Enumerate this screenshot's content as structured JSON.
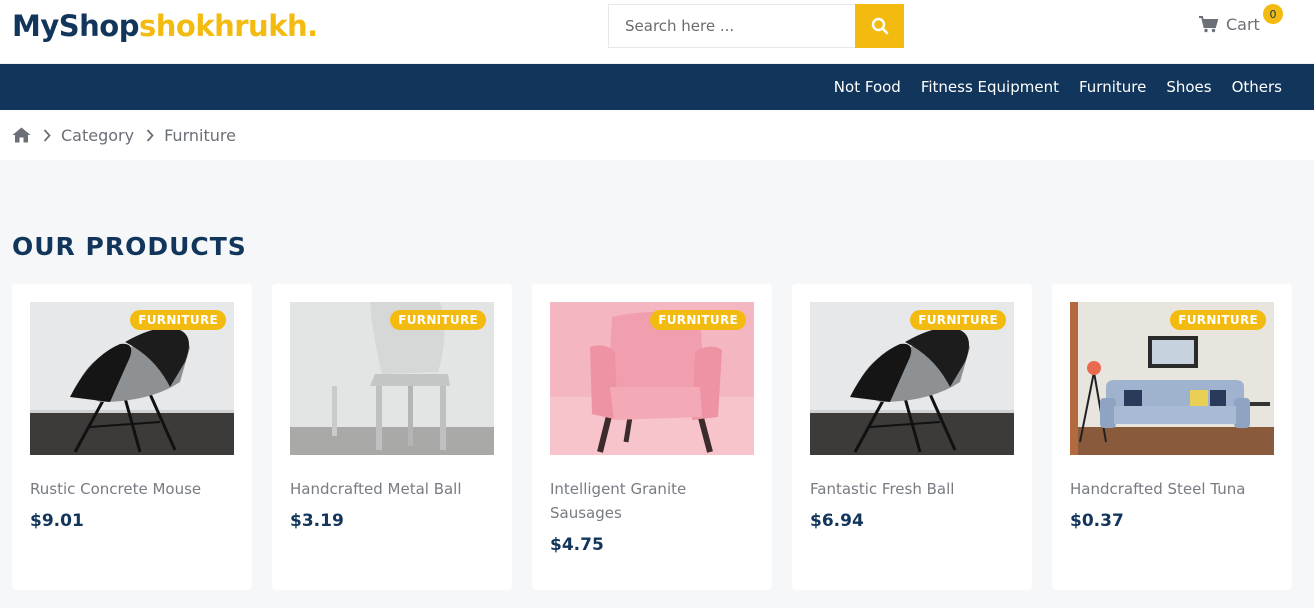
{
  "header": {
    "logo_primary": "MyShop",
    "logo_secondary": "shokhrukh.",
    "search_placeholder": "Search here ...",
    "cart_label": "Cart",
    "cart_count": "0"
  },
  "nav": {
    "items": [
      {
        "label": "Not Food"
      },
      {
        "label": "Fitness Equipment"
      },
      {
        "label": "Furniture"
      },
      {
        "label": "Shoes"
      },
      {
        "label": "Others"
      }
    ]
  },
  "breadcrumb": {
    "items": [
      {
        "label": "Category"
      },
      {
        "label": "Furniture"
      }
    ]
  },
  "products_section": {
    "title": "OUR PRODUCTS",
    "items": [
      {
        "badge": "FURNITURE",
        "name": "Rustic Concrete Mouse",
        "price": "$9.01",
        "image": "black-chair"
      },
      {
        "badge": "FURNITURE",
        "name": "Handcrafted Metal Ball",
        "price": "$3.19",
        "image": "white-chair"
      },
      {
        "badge": "FURNITURE",
        "name": "Intelligent Granite Sausages",
        "price": "$4.75",
        "image": "pink-armchair"
      },
      {
        "badge": "FURNITURE",
        "name": "Fantastic Fresh Ball",
        "price": "$6.94",
        "image": "black-chair"
      },
      {
        "badge": "FURNITURE",
        "name": "Handcrafted Steel Tuna",
        "price": "$0.37",
        "image": "blue-sofa"
      }
    ]
  },
  "colors": {
    "primary": "#12355b",
    "accent": "#f3bb0f",
    "background": "#f6f7f9"
  }
}
